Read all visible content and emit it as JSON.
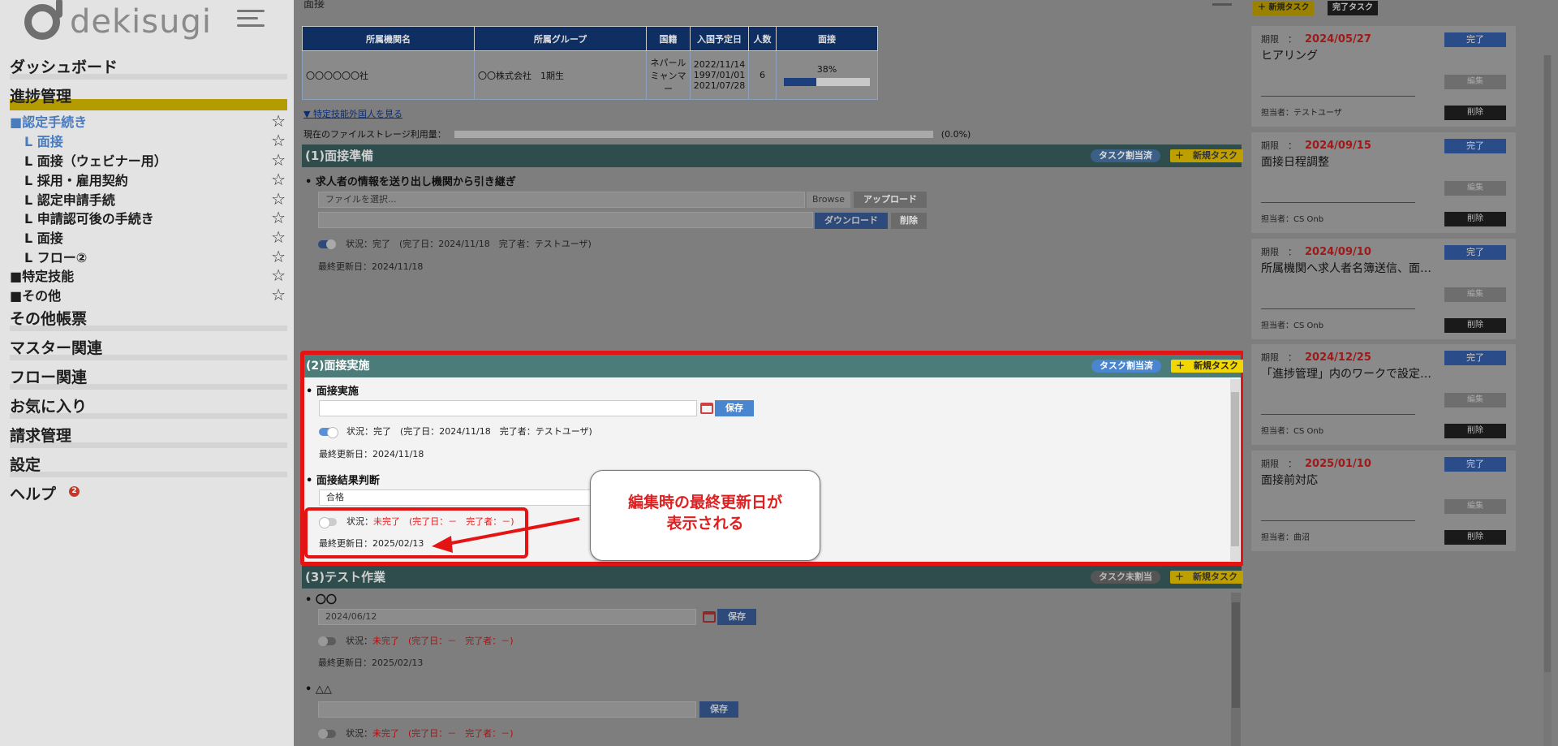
{
  "app": {
    "logo_text": "dekisugi"
  },
  "sidebar": {
    "heads": {
      "dashboard": "ダッシュボード",
      "progress": "進捗管理",
      "other_forms": "その他帳票",
      "master": "マスター関連",
      "flow": "フロー関連",
      "favorites": "お気に入り",
      "billing": "請求管理",
      "settings": "設定",
      "help": "ヘルプ",
      "help_badge": "2"
    },
    "items": [
      {
        "label": "■認定手続き"
      },
      {
        "label": "L 面接"
      },
      {
        "label": "L 面接（ウェビナー用）"
      },
      {
        "label": "L 採用・雇用契約"
      },
      {
        "label": "L 認定申請手続"
      },
      {
        "label": "L 申請認可後の手続き"
      },
      {
        "label": "L 面接"
      },
      {
        "label": "L フロー②"
      },
      {
        "label": "■特定技能"
      },
      {
        "label": "■その他"
      }
    ]
  },
  "main": {
    "page_title": "面接",
    "table": {
      "headers": [
        "所属機関名",
        "所属グループ",
        "国籍",
        "入国予定日",
        "人数",
        "面接"
      ],
      "row": {
        "org": "〇〇〇〇〇〇社",
        "group": "〇〇株式会社　1期生",
        "nationality_1": "ネパール",
        "nationality_2": "ミャンマー",
        "date_1": "2022/11/14",
        "date_2": "1997/01/01",
        "date_3": "2021/07/28",
        "count": "6",
        "progress_label": "38%",
        "progress": 0.38
      }
    },
    "more_link": "▼ 特定技能外国人を見る",
    "storage": {
      "label": "現在のファイルストレージ利用量：",
      "value": "(0.0%)"
    },
    "pills": {
      "assigned": "タスク割当済",
      "unassigned": "タスク未割当",
      "new_task": "＋　新規タスク"
    },
    "section1": {
      "title": "(1)面接準備",
      "task": "求人者の情報を送り出し機関から引き継ぎ",
      "file_placeholder": "ファイルを選択...",
      "browse": "Browse",
      "upload": "アップロード",
      "download": "ダウンロード",
      "delete": "削除",
      "status": "状況：完了　(完了日：2024/11/18　完了者：テストユーザ)",
      "updated": "最終更新日：2024/11/18"
    },
    "section2": {
      "title": "(2)面接実施",
      "task1": "面接実施",
      "save": "保存",
      "status1": "状況：完了　(完了日：2024/11/18　完了者：テストユーザ)",
      "updated1": "最終更新日：2024/11/18",
      "task2": "面接結果判断",
      "select_value": "合格",
      "status2_label": "状況：",
      "status2_value": "未完了　(完了日：－　完了者：－)",
      "updated2": "最終更新日：2025/02/13",
      "callout_line1": "編集時の最終更新日が",
      "callout_line2": "表示される"
    },
    "section3": {
      "title": "(3)テスト作業",
      "task1": "〇〇",
      "date_value": "2024/06/12",
      "save": "保存",
      "status_label": "状況：",
      "status_value": "未完了　(完了日：－　完了者：－)",
      "updated": "最終更新日：2025/02/13",
      "task2": "△△",
      "status2_label": "状況：",
      "status2_value": "未完了　(完了日：－　完了者：－)"
    }
  },
  "right": {
    "new_task": "＋ 新規タスク",
    "done_task": "完了タスク",
    "labels": {
      "due": "期限　：",
      "done": "完了",
      "edit": "編集",
      "delete": "削除",
      "owner_prefix": "担当者："
    },
    "cards": [
      {
        "due": "2024/05/27",
        "title": "ヒアリング",
        "owner": "担当者：テストユーザ"
      },
      {
        "due": "2024/09/15",
        "title": "面接日程調整",
        "owner": "担当者：CS Onb"
      },
      {
        "due": "2024/09/10",
        "title": "所属機関へ求人者名簿送信、面…",
        "owner": "担当者：CS Onb"
      },
      {
        "due": "2024/12/25",
        "title": "「進捗管理」内のワークで設定…",
        "owner": "担当者：CS Onb"
      },
      {
        "due": "2025/01/10",
        "title": "面接前対応",
        "owner": "担当者：曲沼"
      }
    ]
  },
  "colors": {
    "highlight_red": "#e51414",
    "accent_blue": "#4a86d0",
    "new_task_yellow": "#f2d600",
    "header_teal": "#4c7c7a"
  }
}
